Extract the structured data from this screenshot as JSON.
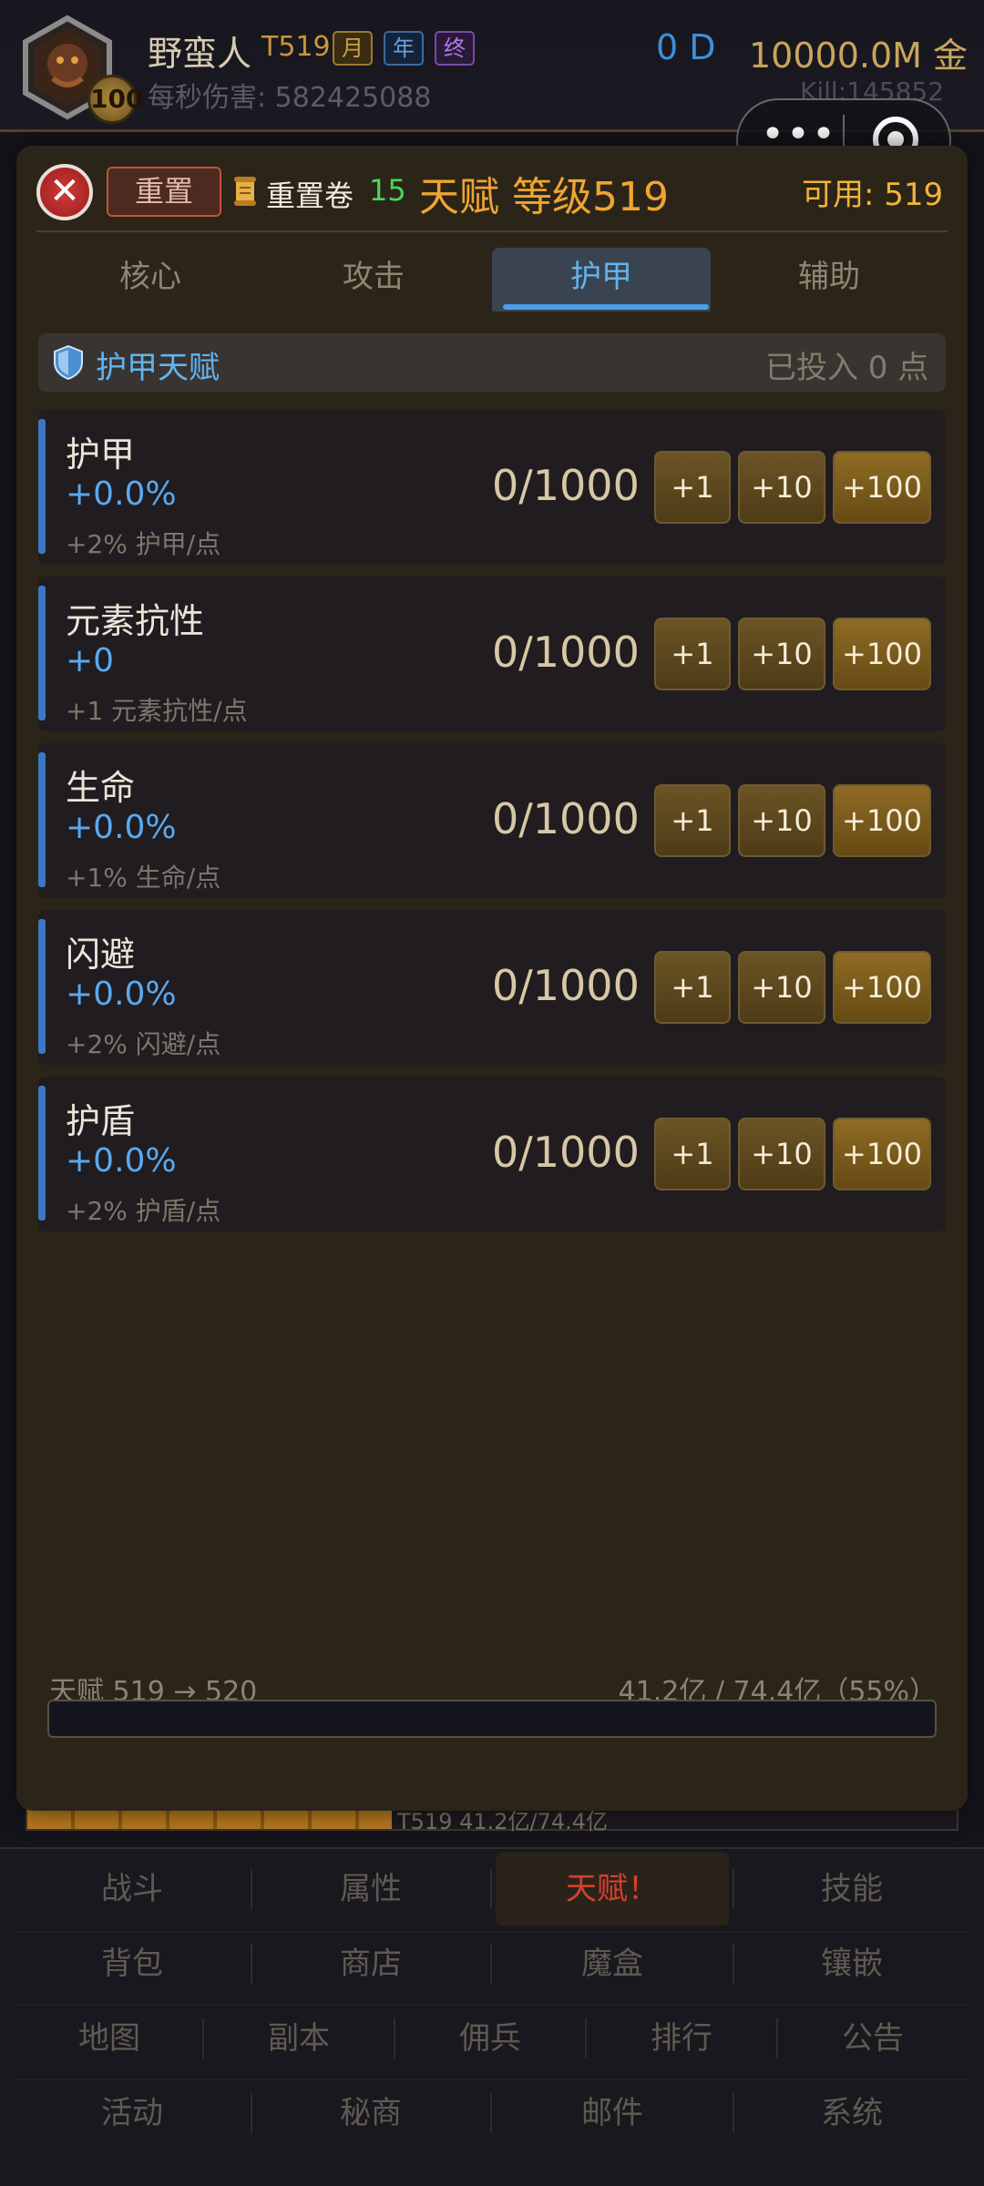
{
  "header": {
    "hero_name": "野蛮人",
    "tier": "T519",
    "level_badge": "100",
    "tags": [
      "月",
      "年",
      "终"
    ],
    "dps_text": "每秒伤害: 582425088",
    "diamond_text": "0 D",
    "gold_text": "10000.0M 金",
    "kill_text": "Kill:145852"
  },
  "miniprogram_capsule": {
    "more_icon": "more-dots-icon",
    "close_icon": "target-circle-icon"
  },
  "background_progress_text": "T519  41.2亿/74.4亿",
  "modal": {
    "close_label": "✕",
    "reset_label": "重置",
    "scroll_label": "重置卷",
    "scroll_count": "15",
    "title": "天赋 等级519",
    "available": "可用: 519",
    "tabs": [
      "核心",
      "攻击",
      "护甲",
      "辅助"
    ],
    "active_tab": "护甲",
    "section": {
      "title": "护甲天赋",
      "invested": "已投入 0 点"
    },
    "talents": [
      {
        "name": "护甲",
        "value": "+0.0%",
        "desc": "+2% 护甲/点",
        "count": "0/1000"
      },
      {
        "name": "元素抗性",
        "value": "+0",
        "desc": "+1 元素抗性/点",
        "count": "0/1000"
      },
      {
        "name": "生命",
        "value": "+0.0%",
        "desc": "+1% 生命/点",
        "count": "0/1000"
      },
      {
        "name": "闪避",
        "value": "+0.0%",
        "desc": "+2% 闪避/点",
        "count": "0/1000"
      },
      {
        "name": "护盾",
        "value": "+0.0%",
        "desc": "+2% 护盾/点",
        "count": "0/1000"
      }
    ],
    "buttons": [
      "+1",
      "+10",
      "+100"
    ],
    "footer": {
      "progress_label": "天赋 519 → 520",
      "progress_value": "41.2亿 / 74.4亿（55%）",
      "progress_fraction": 0.0
    }
  },
  "menu": {
    "row1": [
      "战斗",
      "属性",
      "天赋！",
      "技能"
    ],
    "row2": [
      "背包",
      "商店",
      "魔盒",
      "镶嵌"
    ],
    "row3": [
      "地图",
      "副本",
      "佣兵",
      "排行",
      "公告"
    ],
    "row4": [
      "活动",
      "秘商",
      "邮件",
      "系统"
    ],
    "active": "天赋！"
  },
  "colors": {
    "accent_blue": "#63b3ef",
    "gold": "#f0a432",
    "active_menu": "#d6402e"
  }
}
